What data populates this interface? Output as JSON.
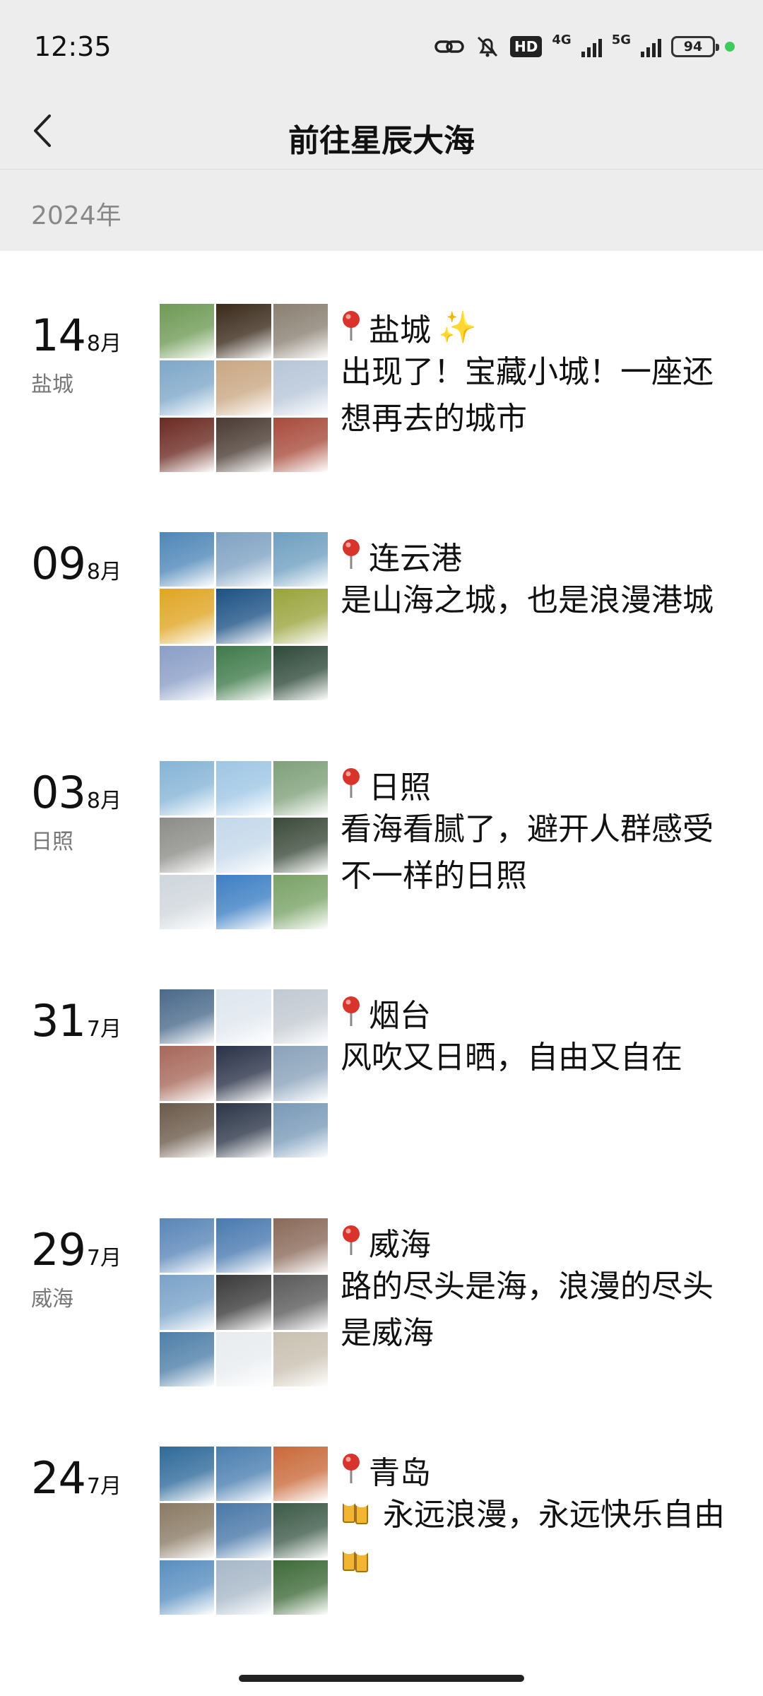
{
  "status_bar": {
    "time": "12:35",
    "hd": "HD",
    "net1": "4G",
    "net2": "5G",
    "battery": "94",
    "icons": [
      "link-icon",
      "bell-muted-icon",
      "hd-icon",
      "signal-4g-icon",
      "signal-5g-icon",
      "battery-icon",
      "status-dot-icon"
    ]
  },
  "nav": {
    "back_icon": "chevron-left-icon",
    "title": "前往星辰大海"
  },
  "year": "2024年",
  "entries": [
    {
      "day": "14",
      "month": "8月",
      "place_sub": "盐城",
      "place": "盐城",
      "place_suffix": "✨",
      "caption": "出现了！宝藏小城！一座还想再去的城市",
      "photo_colors": [
        "#6f9a56",
        "#3a2a1a",
        "#8a8072",
        "#7ea7c8",
        "#c9a783",
        "#b7c6d8",
        "#6b2a22",
        "#4a3b33",
        "#a84b3c"
      ]
    },
    {
      "day": "09",
      "month": "8月",
      "place_sub": "",
      "place": "连云港",
      "place_suffix": "",
      "caption": "是山海之城，也是浪漫港城",
      "photo_colors": [
        "#4f87b8",
        "#7fa2c2",
        "#6f9fc0",
        "#e0a524",
        "#1d5285",
        "#9aa43c",
        "#8a9ec6",
        "#3f7a4a",
        "#2f4a3a"
      ]
    },
    {
      "day": "03",
      "month": "8月",
      "place_sub": "日照",
      "place": "日照",
      "place_suffix": "",
      "caption": "看海看腻了，避开人群感受不一样的日照",
      "photo_colors": [
        "#86b4d6",
        "#9fc6e4",
        "#7fa07a",
        "#8c8c88",
        "#c4d8ea",
        "#3b4a3a",
        "#cfd6dc",
        "#3d7fc4",
        "#79a266"
      ]
    },
    {
      "day": "31",
      "month": "7月",
      "place_sub": "",
      "place": "烟台",
      "place_suffix": "",
      "caption": "风吹又日晒，自由又自在",
      "photo_colors": [
        "#4a6a8a",
        "#dfe6ee",
        "#c2c9d1",
        "#a7685a",
        "#2a3248",
        "#8aa2ba",
        "#6b5a4a",
        "#2c3648",
        "#7a9ab8"
      ]
    },
    {
      "day": "29",
      "month": "7月",
      "place_sub": "威海",
      "place": "威海",
      "place_suffix": "",
      "caption": "路的尽头是海，浪漫的尽头是威海",
      "photo_colors": [
        "#5a86b8",
        "#4a7ab0",
        "#8a6a5a",
        "#7aa2c8",
        "#3a3a3a",
        "#5a5a5a",
        "#4f7fa8",
        "#e8ecef",
        "#c9c0b0"
      ]
    },
    {
      "day": "24",
      "month": "7月",
      "place_sub": "",
      "place": "青岛",
      "place_suffix": "",
      "caption": "永远浪漫，永远快乐自由",
      "photo_colors": [
        "#2f6a9a",
        "#4b7fb0",
        "#c96a3a",
        "#8a7a64",
        "#4a78a8",
        "#3d5a48",
        "#5a8fc0",
        "#a8b8c8",
        "#3f6a3a"
      ]
    }
  ]
}
